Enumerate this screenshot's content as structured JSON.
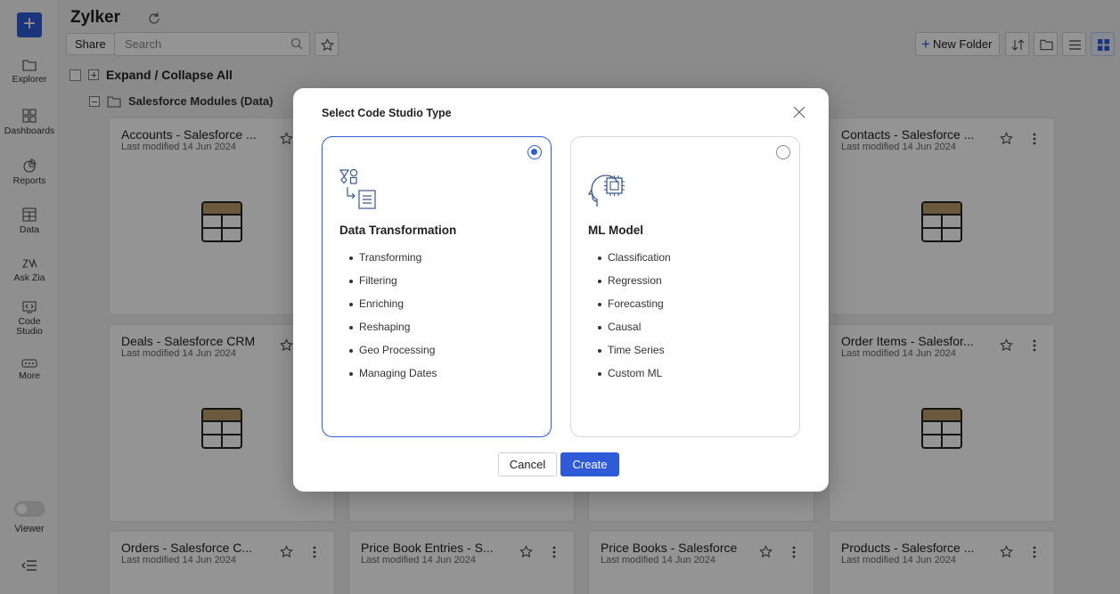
{
  "app": {
    "workspace_title": "Zylker"
  },
  "rail": {
    "items": [
      {
        "label": "Explorer",
        "icon": "folder-icon"
      },
      {
        "label": "Dashboards",
        "icon": "dashboard-icon"
      },
      {
        "label": "Reports",
        "icon": "pie-chart-icon"
      },
      {
        "label": "Data",
        "icon": "table-icon"
      },
      {
        "label": "Ask Zia",
        "icon": "zia-icon"
      },
      {
        "label": "Code Studio",
        "icon": "code-studio-icon"
      },
      {
        "label": "More",
        "icon": "more-dots-icon"
      }
    ],
    "viewer_label": "Viewer"
  },
  "toolbar": {
    "share_label": "Share",
    "search_placeholder": "Search",
    "new_folder_label": "New Folder"
  },
  "explorer": {
    "expand_collapse_label": "Expand / Collapse All",
    "folder_label": "Salesforce Modules (Data)"
  },
  "cards": [
    {
      "title": "Accounts - Salesforce ...",
      "modified": "Last modified 14 Jun 2024"
    },
    {
      "title": "Contacts - Salesforce ...",
      "modified": "Last modified 14 Jun 2024"
    },
    {
      "title": "Deals - Salesforce CRM",
      "modified": "Last modified 14 Jun 2024"
    },
    {
      "title": "Order Items - Salesfor...",
      "modified": "Last modified 14 Jun 2024"
    },
    {
      "title": "Orders - Salesforce C...",
      "modified": "Last modified 14 Jun 2024"
    },
    {
      "title": "Price Book Entries - S...",
      "modified": "Last modified 14 Jun 2024"
    },
    {
      "title": "Price Books - Salesforce",
      "modified": "Last modified 14 Jun 2024"
    },
    {
      "title": "Products - Salesforce ...",
      "modified": "Last modified 14 Jun 2024"
    }
  ],
  "modal": {
    "title": "Select Code Studio Type",
    "options": [
      {
        "title": "Data Transformation",
        "selected": true,
        "icon": "data-transformation-icon",
        "items": [
          "Transforming",
          "Filtering",
          "Enriching",
          "Reshaping",
          "Geo Processing",
          "Managing Dates"
        ]
      },
      {
        "title": "ML Model",
        "selected": false,
        "icon": "ml-model-head-chip-icon",
        "items": [
          "Classification",
          "Regression",
          "Forecasting",
          "Causal",
          "Time Series",
          "Custom ML"
        ]
      }
    ],
    "cancel_label": "Cancel",
    "create_label": "Create"
  },
  "colors": {
    "accent": "#2f5bd6",
    "table_icon_header": "#b89a6a"
  }
}
